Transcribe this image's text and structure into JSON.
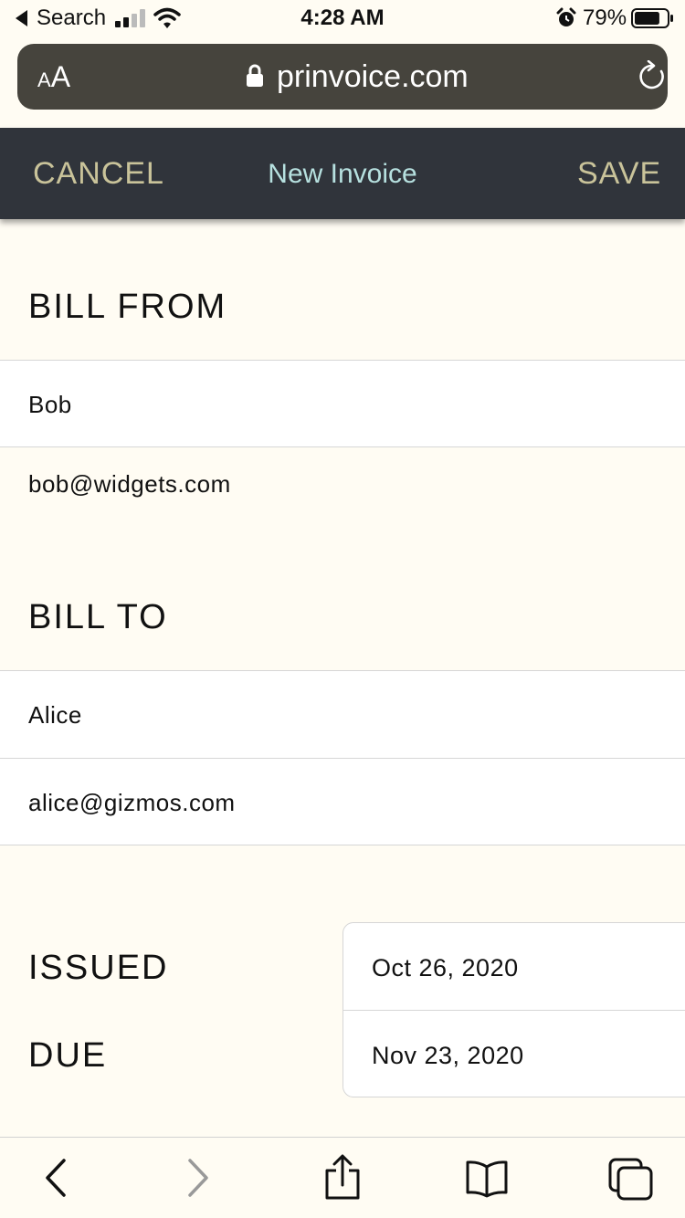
{
  "status_bar": {
    "back_label": "Search",
    "time": "4:28 AM",
    "battery_percent": "79%",
    "battery_level": 0.79,
    "icons": [
      "back-arrow-icon",
      "signal-icon",
      "wifi-icon",
      "alarm-icon",
      "battery-icon"
    ]
  },
  "browser": {
    "text_size_small": "A",
    "text_size_big": "A",
    "url": "prinvoice.com",
    "icons": [
      "lock-icon",
      "reload-icon"
    ]
  },
  "header": {
    "cancel_label": "CANCEL",
    "title": "New Invoice",
    "save_label": "SAVE"
  },
  "bill_from": {
    "heading": "BILL FROM",
    "name": "Bob",
    "email": "bob@widgets.com"
  },
  "bill_to": {
    "heading": "BILL TO",
    "name": "Alice",
    "email": "alice@gizmos.com"
  },
  "dates": {
    "issued_label": "ISSUED",
    "issued_value": "Oct 26, 2020",
    "due_label": "DUE",
    "due_value": "Nov 23, 2020"
  },
  "toolbar": {
    "icons": [
      "back-icon",
      "forward-icon",
      "share-icon",
      "bookmarks-icon",
      "tabs-icon"
    ]
  },
  "colors": {
    "header_bg": "#30343b",
    "header_action": "#c9c39a",
    "header_title": "#b6e0df",
    "page_bg": "#fffcf3",
    "url_bar_bg": "#46443d"
  }
}
